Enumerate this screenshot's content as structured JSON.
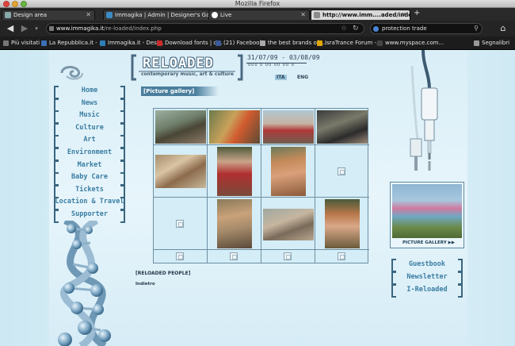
{
  "window": {
    "title": "Mozilla Firefox"
  },
  "tabs": [
    {
      "label": "Design area",
      "active": false
    },
    {
      "label": "Immagika | Admin | Designer's Gall...",
      "active": false
    },
    {
      "label": "Live",
      "active": false
    },
    {
      "label": "http://www.imm....aded/index.php",
      "active": true
    }
  ],
  "nav": {
    "url_host": "www.immagika.it",
    "url_path": "/re-loaded/index.php",
    "search_value": "protection trade"
  },
  "bookmarks": [
    {
      "label": "Più visitati",
      "color": "#777777"
    },
    {
      "label": "La Repubblica.it - ...",
      "color": "#3b6fb6"
    },
    {
      "label": "Immagika.it - Desi...",
      "color": "#2f7fb7"
    },
    {
      "label": "Download fonts | d...",
      "color": "#cc2b2b"
    },
    {
      "label": "(21) Facebook",
      "color": "#3b5998"
    },
    {
      "label": "the best brands of ...",
      "color": "#aaaaaa"
    },
    {
      "label": "IsraTrance Forum -...",
      "color": "#e0a800"
    },
    {
      "label": "www.myspace.com...",
      "color": "#444444"
    },
    {
      "label": "Segnalibri",
      "color": "#999999"
    }
  ],
  "site": {
    "logo": "RELOADED",
    "tagline": "contemporary music, art & culture",
    "dates": "31/07/09 - 03/08/09",
    "date_ticks": "000 0 00 00 00 0",
    "languages": [
      "ITA",
      "ENG"
    ],
    "menu": [
      "Home",
      "News",
      "Music",
      "Culture",
      "Art",
      "Environment",
      "Market",
      "Baby Care",
      "Tickets",
      "Location & Travel",
      "Supporter"
    ],
    "section_title": "[Picture gallery]",
    "caption": "[RELOADED PEOPLE]",
    "back_link": "Indietro",
    "feature_label": "PICTURE GALLERY ▶▶",
    "side_menu": [
      "Guestbook",
      "Newsletter",
      "I-Reloaded"
    ]
  },
  "colors": {
    "menu_text": "#3a7ea3",
    "bracket": "#3a6680",
    "page_bg": "#d9eef7"
  }
}
